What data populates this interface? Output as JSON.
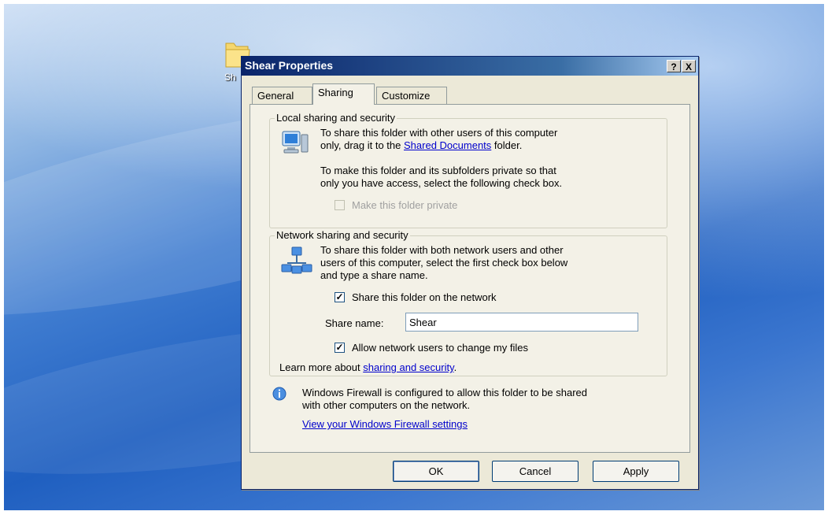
{
  "desktop": {
    "folder_label": "Sh"
  },
  "dialog": {
    "title": "Shear Properties",
    "help_button": "?",
    "close_button": "X",
    "tabs": [
      {
        "label": "General",
        "active": false
      },
      {
        "label": "Sharing",
        "active": true
      },
      {
        "label": "Customize",
        "active": false
      }
    ],
    "local": {
      "legend": "Local sharing and security",
      "text1_a": "To share this folder with other users of this computer",
      "text1_b": "only, drag it to the ",
      "text1_link": "Shared Documents",
      "text1_c": " folder.",
      "text2_a": "To make this folder and its subfolders private so that",
      "text2_b": "only you have access, select the following check box.",
      "private_checkbox_label": "Make this folder private",
      "private_checked": false,
      "private_enabled": false
    },
    "network": {
      "legend": "Network sharing and security",
      "text_a": "To share this folder with both network users and other",
      "text_b": "users of this computer, select the first check box below",
      "text_c": "and type a share name.",
      "share_checkbox_label": "Share this folder on the network",
      "share_checked": true,
      "share_name_label": "Share name:",
      "share_name_value": "Shear",
      "allow_checkbox_label": "Allow network users to change my files",
      "allow_checked": true,
      "learn_more_prefix": "Learn more about ",
      "learn_more_link": "sharing and security",
      "learn_more_suffix": "."
    },
    "firewall": {
      "text_a": "Windows Firewall is configured to allow this folder to be shared",
      "text_b": "with other computers on the network.",
      "link": "View your Windows Firewall settings"
    },
    "buttons": {
      "ok": "OK",
      "cancel": "Cancel",
      "apply": "Apply"
    }
  },
  "colors": {
    "titlebar": "#0a246a",
    "link": "#0000cc",
    "dialog_bg": "#ece9d8"
  }
}
